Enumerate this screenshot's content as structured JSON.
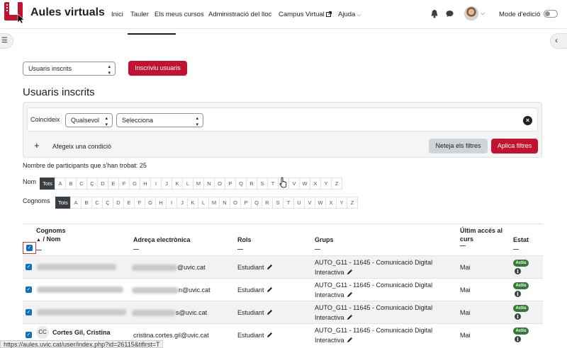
{
  "navbar": {
    "brand": "Aules virtuals",
    "links": [
      "Inici",
      "Tauler",
      "Els meus cursos",
      "Administració del lloc",
      "Campus Virtual",
      "Ajuda"
    ],
    "edit_mode": "Mode d'edició",
    "brand_color": "#c3122f"
  },
  "toolbar": {
    "enrolled_select": "Usuaris inscrits",
    "enrol_button": "Inscriviu usuaris"
  },
  "page_title": "Usuaris inscrits",
  "filters": {
    "match_label": "Coincideix",
    "match_value": "Qualsevol",
    "select_value": "Selecciona",
    "add_condition": "Afegeix una condició",
    "clear_button": "Neteja els filtres",
    "apply_button": "Aplica filtres"
  },
  "participants_count": "Nombre de participants que s'han trobat: 25",
  "initials": {
    "first_label": "Nom",
    "last_label": "Cognoms",
    "all": "Tots",
    "letters": [
      "A",
      "B",
      "C",
      "Ç",
      "D",
      "E",
      "F",
      "G",
      "H",
      "I",
      "J",
      "K",
      "L",
      "M",
      "N",
      "O",
      "P",
      "Q",
      "R",
      "S",
      "T",
      "U",
      "V",
      "W",
      "X",
      "Y",
      "Z"
    ]
  },
  "table": {
    "headers": {
      "lastname": "Cognoms",
      "firstname": "/ Nom",
      "email": "Adreça electrònica",
      "roles": "Rols",
      "groups": "Grups",
      "last_access": "Últim accés al curs",
      "status": "Estat"
    },
    "rows": [
      {
        "name": "",
        "email": "@uvic.cat",
        "role": "Estudiant",
        "group_line1": "AUTO_G11 - 11645 - Comunicació Digital",
        "group_line2": "Interactiva",
        "last_access": "Mai",
        "status": "Actiu"
      },
      {
        "name": "",
        "email": "n@uvic.cat",
        "role": "Estudiant",
        "group_line1": "AUTO_G11 - 11645 - Comunicació Digital",
        "group_line2": "Interactiva",
        "last_access": "Mai",
        "status": "Actiu"
      },
      {
        "name": "",
        "email": "s@uvic.cat",
        "role": "Estudiant",
        "group_line1": "AUTO_G11 - 11645 - Comunicació Digital",
        "group_line2": "Interactiva",
        "last_access": "Mai",
        "status": "Actiu"
      },
      {
        "name": "Cortes Gil, Cristina",
        "initials": "CC",
        "email": "cristina.cortes.gil@uvic.cat",
        "role": "Estudiant",
        "group_line1": "AUTO_G11 - 11645 - Comunicació Digital",
        "group_line2": "Interactiva",
        "last_access": "Mai",
        "status": "Actiu"
      }
    ]
  },
  "status_url": "https://aules.uvic.cat/user/index.php?id=26115&tifirst=T"
}
